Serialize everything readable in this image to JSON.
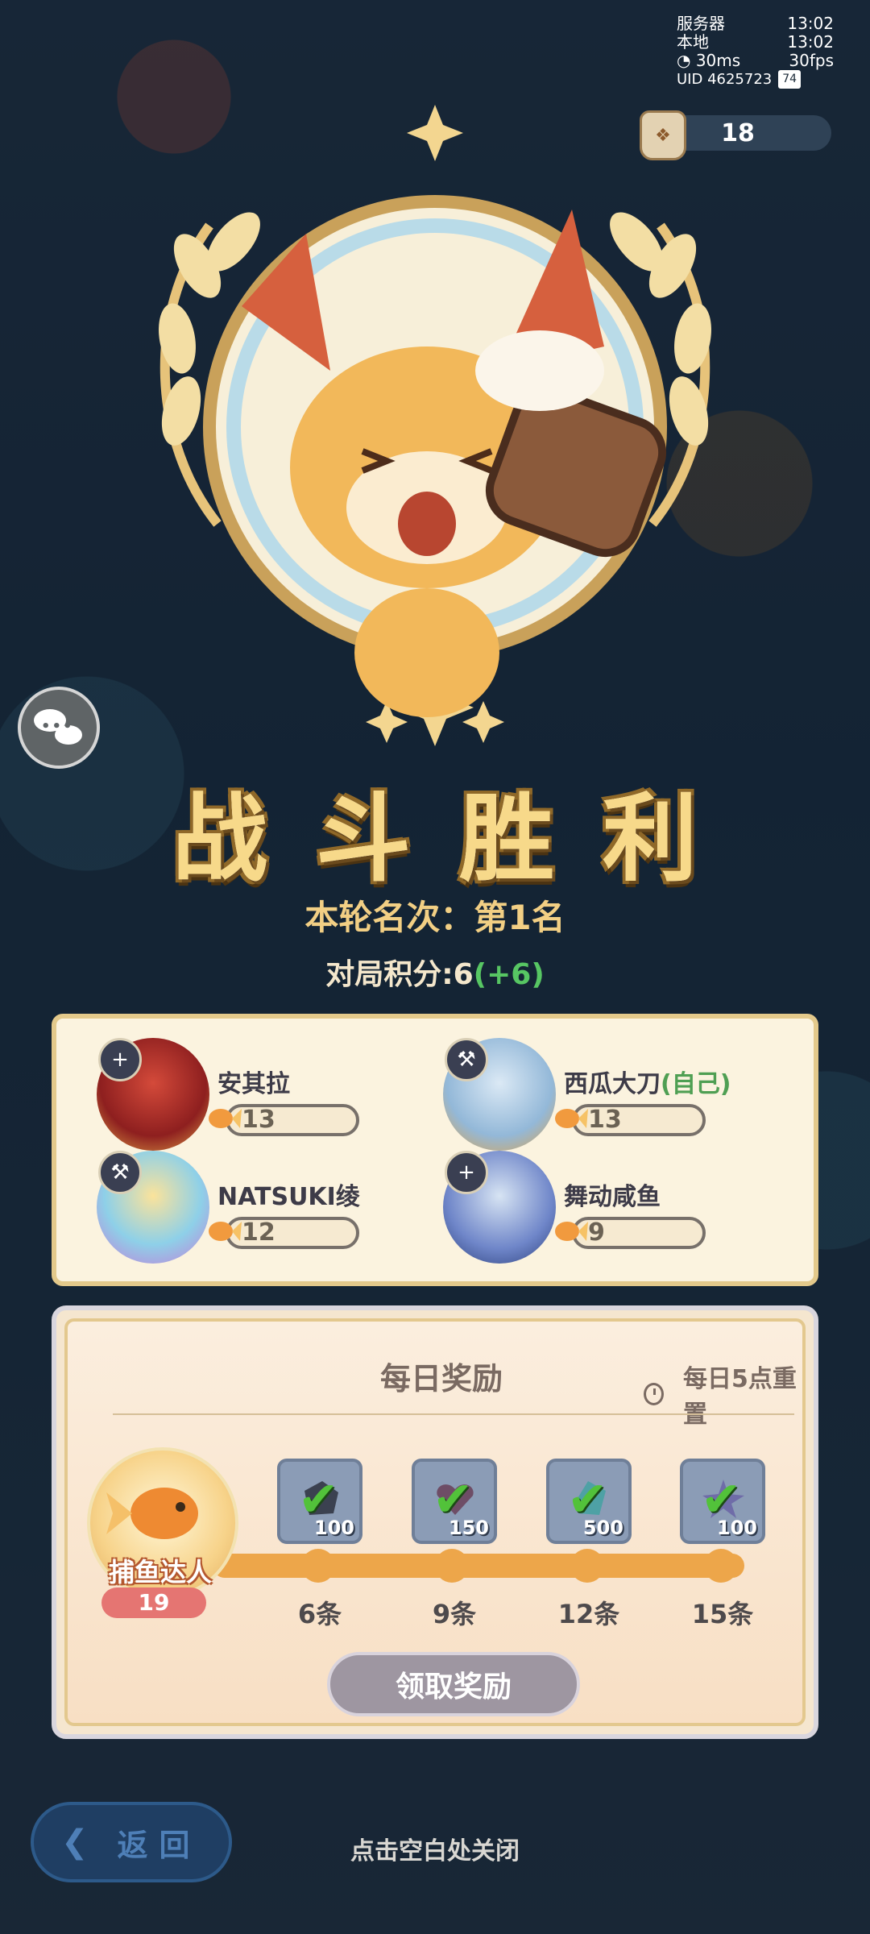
{
  "status": {
    "server_label": "服务器",
    "server_time": "13:02",
    "local_label": "本地",
    "local_time": "13:02",
    "ping": "30ms",
    "fps": "30fps",
    "uid": "UID 4625723",
    "battery": "74"
  },
  "currency": {
    "value": "18",
    "icon": "fish-bag-icon"
  },
  "result": {
    "title": "战斗胜利",
    "rank": "本轮名次：第1名",
    "score_label": "对局积分:6",
    "score_delta": "(+6)"
  },
  "players": [
    {
      "name": "安其拉",
      "self": "",
      "count": "13",
      "badge": "+"
    },
    {
      "name": "西瓜大刀",
      "self": "(自己)",
      "count": "13",
      "badge": "⚒"
    },
    {
      "name": "NATSUKI绫",
      "self": "",
      "count": "12",
      "badge": "⚒"
    },
    {
      "name": "舞动咸鱼",
      "self": "",
      "count": "9",
      "badge": "+"
    }
  ],
  "rewards": {
    "title": "每日奖励",
    "reset": "每日5点重置",
    "medal_label": "捕鱼达人",
    "medal_count": "19",
    "milestones": [
      {
        "label": "6条",
        "qty": "100",
        "claimed": true
      },
      {
        "label": "9条",
        "qty": "150",
        "claimed": true
      },
      {
        "label": "12条",
        "qty": "500",
        "claimed": true
      },
      {
        "label": "15条",
        "qty": "100",
        "claimed": true
      }
    ],
    "claim_button": "领取奖励"
  },
  "back_button": "返回",
  "close_hint": "点击空白处关闭",
  "colors": {
    "accent": "#eda64a",
    "gold": "#f7d98a",
    "green": "#57c663"
  }
}
